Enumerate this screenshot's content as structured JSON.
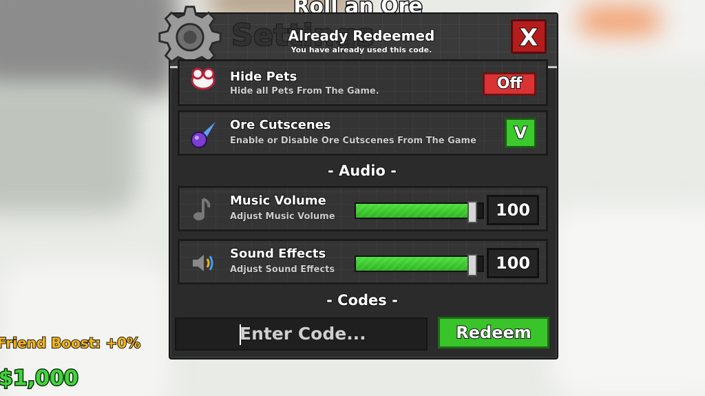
{
  "game_title": "Roll an Ore",
  "window": {
    "title": "Settings",
    "close_label": "X"
  },
  "notification": {
    "title": "Already Redeemed",
    "message": "You have already used this code."
  },
  "settings": {
    "hide_pets": {
      "label": "Hide Pets",
      "description": "Hide all Pets From The Game.",
      "toggle_label": "Off",
      "toggle_color": "#d93333"
    },
    "ore_cutscenes": {
      "label": "Ore Cutscenes",
      "description": "Enable or Disable Ore Cutscenes From The Game",
      "toggle_label": "V",
      "toggle_color": "#3cc92d"
    }
  },
  "audio": {
    "heading": "- Audio -",
    "music": {
      "label": "Music Volume",
      "description": "Adjust Music Volume",
      "value": "100",
      "level": 0.92
    },
    "sfx": {
      "label": "Sound Effects",
      "description": "Adjust Sound Effects",
      "value": "100",
      "level": 0.92
    }
  },
  "codes": {
    "heading": "- Codes -",
    "placeholder": "Enter Code...",
    "redeem_label": "Redeem"
  },
  "hud": {
    "friend_boost": "Friend Boost: +0%",
    "money": "$1,000"
  },
  "colors": {
    "accent_green": "#3cc92d",
    "accent_red": "#b51d1d",
    "money_green": "#3fd63a",
    "boost_yellow": "#f5b315"
  }
}
